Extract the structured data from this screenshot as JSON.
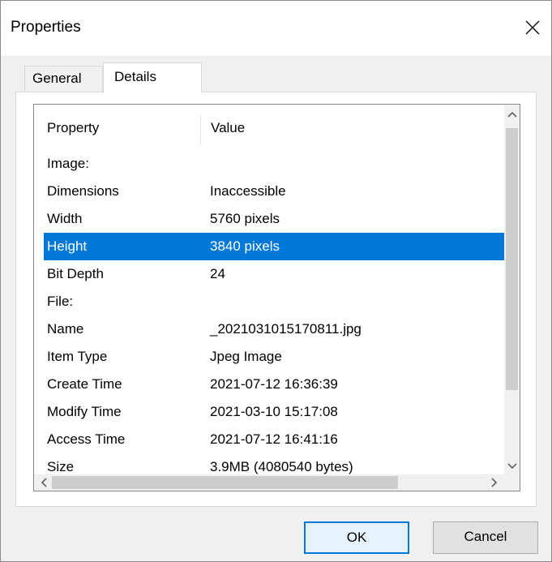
{
  "window": {
    "title": "Properties",
    "close_icon": "close-icon"
  },
  "tabs": [
    {
      "label": "General",
      "active": false
    },
    {
      "label": "Details",
      "active": true
    }
  ],
  "list": {
    "columns": [
      "Property",
      "Value"
    ],
    "rows": [
      {
        "property": "Image:",
        "value": ""
      },
      {
        "property": "Dimensions",
        "value": "Inaccessible"
      },
      {
        "property": "Width",
        "value": "5760 pixels"
      },
      {
        "property": "Height",
        "value": "3840 pixels",
        "selected": true
      },
      {
        "property": "Bit Depth",
        "value": "24"
      },
      {
        "property": "File:",
        "value": ""
      },
      {
        "property": "Name",
        "value": "_2021031015170811.jpg"
      },
      {
        "property": "Item Type",
        "value": "Jpeg Image"
      },
      {
        "property": "Create Time",
        "value": "2021-07-12 16:36:39"
      },
      {
        "property": "Modify Time",
        "value": "2021-03-10 15:17:08"
      },
      {
        "property": "Access Time",
        "value": "2021-07-12 16:41:16"
      },
      {
        "property": "Size",
        "value": "3.9MB (4080540 bytes)"
      }
    ]
  },
  "buttons": {
    "ok": "OK",
    "cancel": "Cancel"
  },
  "colors": {
    "selection": "#0078d7",
    "default_button_border": "#0078d7"
  }
}
